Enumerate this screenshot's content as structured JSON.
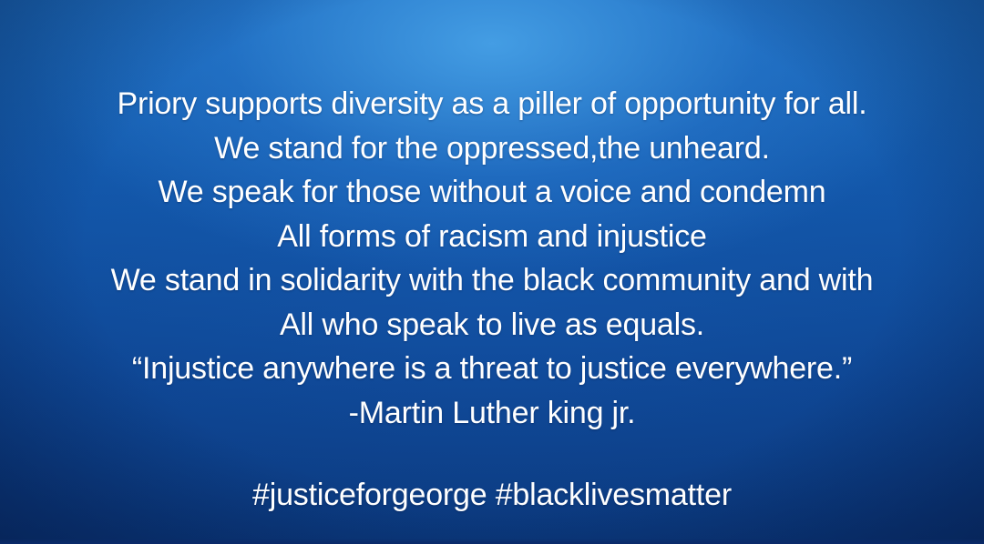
{
  "statement": {
    "lines": [
      "Priory supports diversity as a piller of opportunity for all.",
      "We stand for the oppressed,the unheard.",
      "We speak for those without a voice and condemn",
      "All forms of racism and injustice",
      "We stand in solidarity with the black community and with",
      "All who speak to live as equals.",
      "“Injustice anywhere is a threat to justice everywhere.”",
      "-Martin Luther king jr."
    ]
  },
  "hashtags": "#justiceforgeorge #blacklivesmatter",
  "colors": {
    "background_top": "#1c6dbf",
    "background_bottom": "#0a3679",
    "text": "#ffffff"
  }
}
